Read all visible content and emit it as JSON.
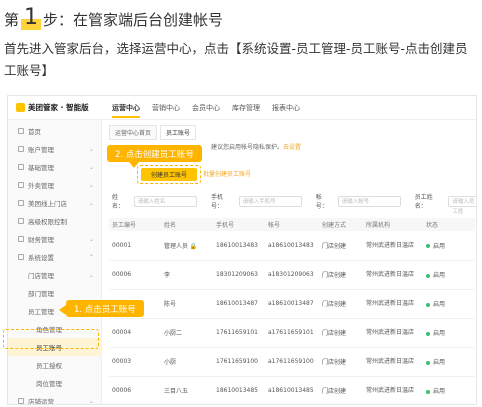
{
  "heading": {
    "prefix": "第",
    "num": "1",
    "suffix": "步：在管家端后台创建帐号"
  },
  "description": "首先进入管家后台，选择运营中心，点击【系统设置-员工管理-员工账号-点击创建员工账号】",
  "app": {
    "logo": "美团管家 · 智能版",
    "topnav": [
      "运营中心",
      "营销中心",
      "会员中心",
      "库存管理",
      "报表中心"
    ],
    "sidebar": [
      {
        "label": "首页",
        "level": 0
      },
      {
        "label": "账户管理",
        "level": 0
      },
      {
        "label": "基础管理",
        "level": 0
      },
      {
        "label": "外卖管理",
        "level": 0
      },
      {
        "label": "美团线上门店",
        "level": 0
      },
      {
        "label": "高级权限控制",
        "level": 0
      },
      {
        "label": "财务管理",
        "level": 0
      },
      {
        "label": "系统设置",
        "level": 0
      },
      {
        "label": "门店管理",
        "level": 1
      },
      {
        "label": "部门管理",
        "level": 1
      },
      {
        "label": "员工管理",
        "level": 1
      },
      {
        "label": "角色管理",
        "level": 2
      },
      {
        "label": "员工账号",
        "level": 2
      },
      {
        "label": "员工授权",
        "level": 2
      },
      {
        "label": "岗位管理",
        "level": 2
      },
      {
        "label": "店铺运营",
        "level": 0
      }
    ],
    "tabs": [
      "运营中心首页",
      "员工账号"
    ],
    "notice": {
      "text": "建议您启用帐号隐私保护。",
      "link": "去设置"
    },
    "create_button": "创建员工账号",
    "import_button": "批量创建员工账号",
    "filters": [
      {
        "label": "姓名：",
        "placeholder": "请输入姓名"
      },
      {
        "label": "手机号：",
        "placeholder": "请输入手机号"
      },
      {
        "label": "帐号：",
        "placeholder": "请输入帐号"
      },
      {
        "label": "员工姓名：",
        "placeholder": "请输入员工姓"
      }
    ],
    "table": {
      "headers": [
        "员工编号",
        "姓名",
        "手机号",
        "帐号",
        "创建方式",
        "所属机构",
        "状态"
      ],
      "rows": [
        [
          "00001",
          "管理人员 🔒",
          "18610013483",
          "a18610013483",
          "门店创建",
          "常州武进新日温店",
          "启用"
        ],
        [
          "00006",
          "李",
          "18301209063",
          "a18301209063",
          "门店创建",
          "常州武进新日温店",
          "启用"
        ],
        [
          "",
          "陈号",
          "18610013487",
          "a18610013487",
          "门店创建",
          "常州武进新日温店",
          "启用"
        ],
        [
          "00004",
          "小厨二",
          "17611659101",
          "a17611659101",
          "门店创建",
          "常州武进新日温店",
          "启用"
        ],
        [
          "00003",
          "小厨",
          "17611659100",
          "a17611659100",
          "门店创建",
          "常州武进新日温店",
          "启用"
        ],
        [
          "00006",
          "三目八五",
          "18610013485",
          "a18610013485",
          "门店创建",
          "常州武进新日温店",
          "启用"
        ]
      ]
    }
  },
  "callouts": {
    "create": "2. 点击创建员工账号",
    "staff": "1. 点击员工账号"
  }
}
